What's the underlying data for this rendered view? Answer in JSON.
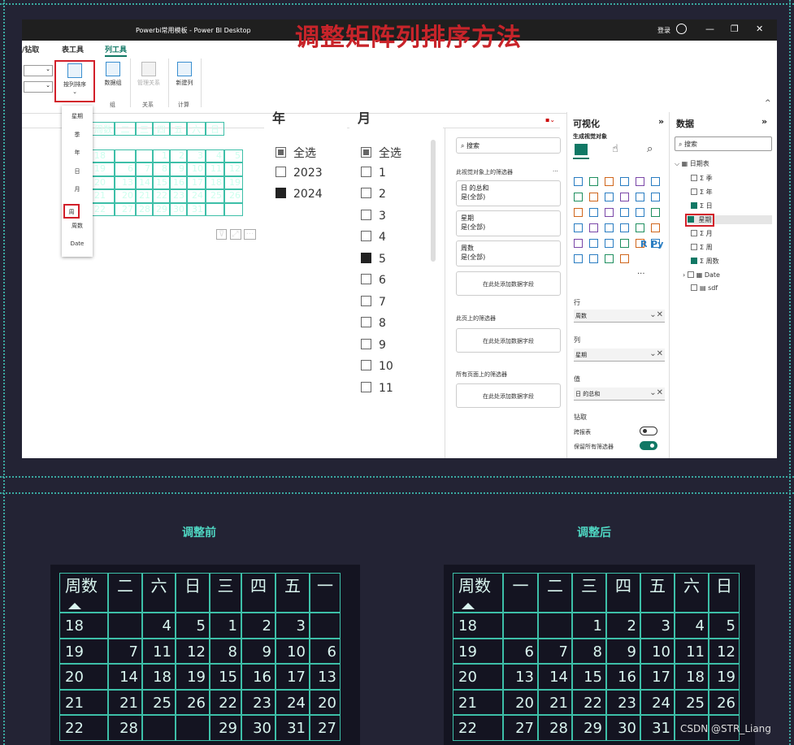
{
  "window": {
    "title": "Powerbi常用模板 - Power BI Desktop",
    "login": "登录",
    "minimize": "—",
    "restore": "❐",
    "close": "✕"
  },
  "headline": "调整矩阵列排序方法",
  "ribbon": {
    "tabs": [
      "/钻取",
      "表工具",
      "列工具"
    ],
    "active_tab": "列工具",
    "buttons": {
      "sort_by_column": "按列排序",
      "data_groups": "数据组",
      "manage_relationships": "管理关系",
      "new_column": "新建列"
    },
    "groups": [
      "组",
      "关系",
      "计算"
    ]
  },
  "sort_menu": {
    "items": [
      "星期",
      "季",
      "年",
      "日",
      "月",
      "周",
      "周数",
      "Date"
    ],
    "selected": "周"
  },
  "canvas_matrix": {
    "header": [
      "周数",
      "二",
      "三",
      "四",
      "五",
      "六",
      "日"
    ],
    "rows": [
      [
        "18",
        "",
        "",
        "1",
        "2",
        "3",
        "4",
        "5"
      ],
      [
        "19",
        "6",
        "7",
        "8",
        "9",
        "10",
        "11",
        "12"
      ],
      [
        "20",
        "13",
        "14",
        "15",
        "16",
        "17",
        "18",
        "19"
      ],
      [
        "21",
        "20",
        "21",
        "22",
        "23",
        "24",
        "25",
        "26"
      ],
      [
        "22",
        "27",
        "28",
        "29",
        "30",
        "31",
        "",
        ""
      ]
    ]
  },
  "year_slicer": {
    "header": "年",
    "options": [
      {
        "label": "全选",
        "state": "partial"
      },
      {
        "label": "2023",
        "state": "off"
      },
      {
        "label": "2024",
        "state": "on"
      }
    ]
  },
  "month_slicer": {
    "header": "月",
    "options": [
      {
        "label": "全选",
        "state": "partial"
      },
      {
        "label": "1",
        "state": "off"
      },
      {
        "label": "2",
        "state": "off"
      },
      {
        "label": "3",
        "state": "off"
      },
      {
        "label": "4",
        "state": "off"
      },
      {
        "label": "5",
        "state": "on"
      },
      {
        "label": "6",
        "state": "off"
      },
      {
        "label": "7",
        "state": "off"
      },
      {
        "label": "8",
        "state": "off"
      },
      {
        "label": "9",
        "state": "off"
      },
      {
        "label": "10",
        "state": "off"
      },
      {
        "label": "11",
        "state": "off"
      }
    ]
  },
  "filters": {
    "search_placeholder": "搜索",
    "visual_section": "此视觉对象上的筛选器",
    "cards": [
      {
        "line1": "日 的总和",
        "line2": "是(全部)"
      },
      {
        "line1": "星期",
        "line2": "是(全部)"
      },
      {
        "line1": "周数",
        "line2": "是(全部)"
      }
    ],
    "add_field": "在此处添加数据字段",
    "page_section": "此页上的筛选器",
    "all_pages_section": "所有页面上的筛选器"
  },
  "viz": {
    "title": "可视化",
    "build_visual": "生成视觉对象",
    "rows_label": "行",
    "rows_value": "周数",
    "cols_label": "列",
    "cols_value": "星期",
    "values_label": "值",
    "values_value": "日 的总和",
    "drill_label": "钻取",
    "cross_report": "跨报表",
    "keep_filters": "保留所有筛选器",
    "r_label": "R",
    "py_label": "Py",
    "more": "···",
    "expand": "»"
  },
  "data_pane": {
    "title": "数据",
    "search_placeholder": "搜索",
    "table": "日期表",
    "fields": [
      {
        "label": "季",
        "sigma": true,
        "checked": false
      },
      {
        "label": "年",
        "sigma": true,
        "checked": false
      },
      {
        "label": "日",
        "sigma": true,
        "checked": true
      },
      {
        "label": "星期",
        "sigma": false,
        "checked": true
      },
      {
        "label": "月",
        "sigma": true,
        "checked": false
      },
      {
        "label": "周",
        "sigma": true,
        "checked": false
      },
      {
        "label": "周数",
        "sigma": true,
        "checked": true
      }
    ],
    "date_field": "Date",
    "other_table": "sdf",
    "expand": "»"
  },
  "bottom_left": {
    "title": "调整前",
    "header": [
      "周数",
      "二",
      "六",
      "日",
      "三",
      "四",
      "五",
      "一"
    ],
    "rows": [
      [
        "18",
        "",
        "4",
        "5",
        "1",
        "2",
        "3",
        ""
      ],
      [
        "19",
        "7",
        "11",
        "12",
        "8",
        "9",
        "10",
        "6"
      ],
      [
        "20",
        "14",
        "18",
        "19",
        "15",
        "16",
        "17",
        "13"
      ],
      [
        "21",
        "21",
        "25",
        "26",
        "22",
        "23",
        "24",
        "20"
      ],
      [
        "22",
        "28",
        "",
        "",
        "29",
        "30",
        "31",
        "27"
      ]
    ]
  },
  "bottom_right": {
    "title": "调整后",
    "header": [
      "周数",
      "一",
      "二",
      "三",
      "四",
      "五",
      "六",
      "日"
    ],
    "rows": [
      [
        "18",
        "",
        "",
        "1",
        "2",
        "3",
        "4",
        "5"
      ],
      [
        "19",
        "6",
        "7",
        "8",
        "9",
        "10",
        "11",
        "12"
      ],
      [
        "20",
        "13",
        "14",
        "15",
        "16",
        "17",
        "18",
        "19"
      ],
      [
        "21",
        "20",
        "21",
        "22",
        "23",
        "24",
        "25",
        "26"
      ],
      [
        "22",
        "27",
        "28",
        "29",
        "30",
        "31",
        "",
        ""
      ]
    ]
  },
  "watermark": "CSDN @STR_Liang",
  "colors": {
    "accent": "#3dbfa8",
    "title_red": "#c8242a",
    "dark_bg": "#232334",
    "brand_green": "#117865"
  }
}
